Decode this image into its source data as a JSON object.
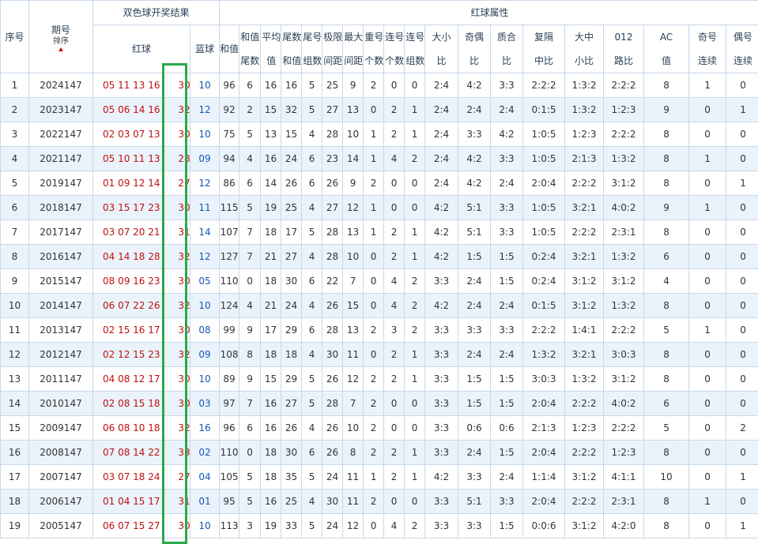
{
  "header": {
    "seq_label": "序号",
    "issue_label": "期号",
    "sort_label": "排序",
    "draw_group_label": "双色球开奖结果",
    "red_label": "红球",
    "blue_label": "蓝球",
    "attr_group_label": "红球属性",
    "cols": [
      "和值",
      "和值尾数",
      "平均值",
      "尾数和值",
      "尾号组数",
      "极限间距",
      "最大间距",
      "重号个数",
      "连号个数",
      "连号组数",
      "大小比",
      "奇偶比",
      "质合比",
      "复隔中比",
      "大中小比",
      "012路比",
      "AC值",
      "奇号连续",
      "偶号连续"
    ]
  },
  "rows": [
    {
      "seq": "1",
      "issue": "2024147",
      "red": "05 11 13 16 2",
      "last": "30",
      "blue": "10",
      "v": [
        "96",
        "6",
        "16",
        "16",
        "5",
        "25",
        "9",
        "2",
        "0",
        "0",
        "2:4",
        "4:2",
        "3:3",
        "2:2:2",
        "1:3:2",
        "2:2:2",
        "8",
        "1",
        "0"
      ]
    },
    {
      "seq": "2",
      "issue": "2023147",
      "red": "05 06 14 16 1",
      "last": "32",
      "blue": "12",
      "v": [
        "92",
        "2",
        "15",
        "32",
        "5",
        "27",
        "13",
        "0",
        "2",
        "1",
        "2:4",
        "2:4",
        "2:4",
        "0:1:5",
        "1:3:2",
        "1:2:3",
        "9",
        "0",
        "1"
      ]
    },
    {
      "seq": "3",
      "issue": "2022147",
      "red": "02 03 07 13 2",
      "last": "30",
      "blue": "10",
      "v": [
        "75",
        "5",
        "13",
        "15",
        "4",
        "28",
        "10",
        "1",
        "2",
        "1",
        "2:4",
        "3:3",
        "4:2",
        "1:0:5",
        "1:2:3",
        "2:2:2",
        "8",
        "0",
        "0"
      ]
    },
    {
      "seq": "4",
      "issue": "2021147",
      "red": "05 10 11 13 2",
      "last": "28",
      "blue": "09",
      "v": [
        "94",
        "4",
        "16",
        "24",
        "6",
        "23",
        "14",
        "1",
        "4",
        "2",
        "2:4",
        "4:2",
        "3:3",
        "1:0:5",
        "2:1:3",
        "1:3:2",
        "8",
        "1",
        "0"
      ]
    },
    {
      "seq": "5",
      "issue": "2019147",
      "red": "01 09 12 14 2",
      "last": "27",
      "blue": "12",
      "v": [
        "86",
        "6",
        "14",
        "26",
        "6",
        "26",
        "9",
        "2",
        "0",
        "0",
        "2:4",
        "4:2",
        "2:4",
        "2:0:4",
        "2:2:2",
        "3:1:2",
        "8",
        "0",
        "1"
      ]
    },
    {
      "seq": "6",
      "issue": "2018147",
      "red": "03 15 17 23 2",
      "last": "30",
      "blue": "11",
      "v": [
        "115",
        "5",
        "19",
        "25",
        "4",
        "27",
        "12",
        "1",
        "0",
        "0",
        "4:2",
        "5:1",
        "3:3",
        "1:0:5",
        "3:2:1",
        "4:0:2",
        "9",
        "1",
        "0"
      ]
    },
    {
      "seq": "7",
      "issue": "2017147",
      "red": "03 07 20 21 2",
      "last": "31",
      "blue": "14",
      "v": [
        "107",
        "7",
        "18",
        "17",
        "5",
        "28",
        "13",
        "1",
        "2",
        "1",
        "4:2",
        "5:1",
        "3:3",
        "1:0:5",
        "2:2:2",
        "2:3:1",
        "8",
        "0",
        "0"
      ]
    },
    {
      "seq": "8",
      "issue": "2016147",
      "red": "04 14 18 28 3",
      "last": "32",
      "blue": "12",
      "v": [
        "127",
        "7",
        "21",
        "27",
        "4",
        "28",
        "10",
        "0",
        "2",
        "1",
        "4:2",
        "1:5",
        "1:5",
        "0:2:4",
        "3:2:1",
        "1:3:2",
        "6",
        "0",
        "0"
      ]
    },
    {
      "seq": "9",
      "issue": "2015147",
      "red": "08 09 16 23 2",
      "last": "30",
      "blue": "05",
      "v": [
        "110",
        "0",
        "18",
        "30",
        "6",
        "22",
        "7",
        "0",
        "4",
        "2",
        "3:3",
        "2:4",
        "1:5",
        "0:2:4",
        "3:1:2",
        "3:1:2",
        "4",
        "0",
        "0"
      ]
    },
    {
      "seq": "10",
      "issue": "2014147",
      "red": "06 07 22 26 3",
      "last": "32",
      "blue": "10",
      "v": [
        "124",
        "4",
        "21",
        "24",
        "4",
        "26",
        "15",
        "0",
        "4",
        "2",
        "4:2",
        "2:4",
        "2:4",
        "0:1:5",
        "3:1:2",
        "1:3:2",
        "8",
        "0",
        "0"
      ]
    },
    {
      "seq": "11",
      "issue": "2013147",
      "red": "02 15 16 17 1",
      "last": "30",
      "blue": "08",
      "v": [
        "99",
        "9",
        "17",
        "29",
        "6",
        "28",
        "13",
        "2",
        "3",
        "2",
        "3:3",
        "3:3",
        "3:3",
        "2:2:2",
        "1:4:1",
        "2:2:2",
        "5",
        "1",
        "0"
      ]
    },
    {
      "seq": "12",
      "issue": "2012147",
      "red": "02 12 15 23 2",
      "last": "32",
      "blue": "09",
      "v": [
        "108",
        "8",
        "18",
        "18",
        "4",
        "30",
        "11",
        "0",
        "2",
        "1",
        "3:3",
        "2:4",
        "2:4",
        "1:3:2",
        "3:2:1",
        "3:0:3",
        "8",
        "0",
        "0"
      ]
    },
    {
      "seq": "13",
      "issue": "2011147",
      "red": "04 08 12 17 1",
      "last": "30",
      "blue": "10",
      "v": [
        "89",
        "9",
        "15",
        "29",
        "5",
        "26",
        "12",
        "2",
        "2",
        "1",
        "3:3",
        "1:5",
        "1:5",
        "3:0:3",
        "1:3:2",
        "3:1:2",
        "8",
        "0",
        "0"
      ]
    },
    {
      "seq": "14",
      "issue": "2010147",
      "red": "02 08 15 18 2",
      "last": "30",
      "blue": "03",
      "v": [
        "97",
        "7",
        "16",
        "27",
        "5",
        "28",
        "7",
        "2",
        "0",
        "0",
        "3:3",
        "1:5",
        "1:5",
        "2:0:4",
        "2:2:2",
        "4:0:2",
        "6",
        "0",
        "0"
      ]
    },
    {
      "seq": "15",
      "issue": "2009147",
      "red": "06 08 10 18 2",
      "last": "32",
      "blue": "16",
      "v": [
        "96",
        "6",
        "16",
        "26",
        "4",
        "26",
        "10",
        "2",
        "0",
        "0",
        "3:3",
        "0:6",
        "0:6",
        "2:1:3",
        "1:2:3",
        "2:2:2",
        "5",
        "0",
        "2"
      ]
    },
    {
      "seq": "16",
      "issue": "2008147",
      "red": "07 08 14 22 2",
      "last": "33",
      "blue": "02",
      "v": [
        "110",
        "0",
        "18",
        "30",
        "6",
        "26",
        "8",
        "2",
        "2",
        "1",
        "3:3",
        "2:4",
        "1:5",
        "2:0:4",
        "2:2:2",
        "1:2:3",
        "8",
        "0",
        "0"
      ]
    },
    {
      "seq": "17",
      "issue": "2007147",
      "red": "03 07 18 24 2",
      "last": "27",
      "blue": "04",
      "v": [
        "105",
        "5",
        "18",
        "35",
        "5",
        "24",
        "11",
        "1",
        "2",
        "1",
        "4:2",
        "3:3",
        "2:4",
        "1:1:4",
        "3:1:2",
        "4:1:1",
        "10",
        "0",
        "1"
      ]
    },
    {
      "seq": "18",
      "issue": "2006147",
      "red": "01 04 15 17 2",
      "last": "31",
      "blue": "01",
      "v": [
        "95",
        "5",
        "16",
        "25",
        "4",
        "30",
        "11",
        "2",
        "0",
        "0",
        "3:3",
        "5:1",
        "3:3",
        "2:0:4",
        "2:2:2",
        "2:3:1",
        "8",
        "1",
        "0"
      ]
    },
    {
      "seq": "19",
      "issue": "2005147",
      "red": "06 07 15 27 2",
      "last": "30",
      "blue": "10",
      "v": [
        "113",
        "3",
        "19",
        "33",
        "5",
        "24",
        "12",
        "0",
        "4",
        "2",
        "3:3",
        "3:3",
        "1:5",
        "0:0:6",
        "3:1:2",
        "4:2:0",
        "8",
        "0",
        "1"
      ]
    }
  ]
}
